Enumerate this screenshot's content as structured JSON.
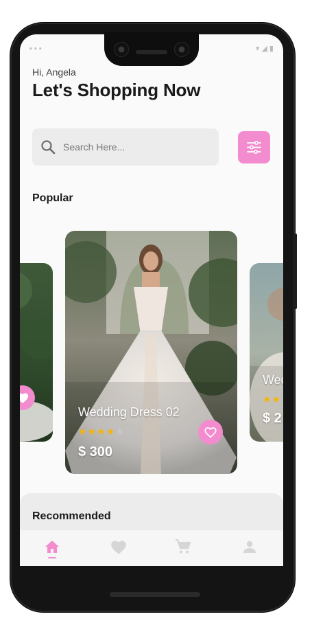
{
  "header": {
    "greeting": "Hi, Angela",
    "title": "Let's Shopping Now"
  },
  "search": {
    "placeholder": "Search Here...",
    "icon": "search-icon"
  },
  "filter": {
    "icon": "sliders-icon"
  },
  "sections": {
    "popular": "Popular",
    "recommended": "Recommended"
  },
  "popular_cards": {
    "left": {
      "icon": "heart-icon"
    },
    "main": {
      "title": "Wedding Dress 02",
      "rating": 4,
      "max_rating": 5,
      "price": "$ 300",
      "icon": "heart-outline-icon"
    },
    "right": {
      "title": "Wed",
      "rating": 2,
      "price": "$ 2"
    }
  },
  "bottom_nav": {
    "items": [
      {
        "icon": "home-icon",
        "active": true
      },
      {
        "icon": "heart-icon",
        "active": false
      },
      {
        "icon": "cart-icon",
        "active": false
      },
      {
        "icon": "person-icon",
        "active": false
      }
    ]
  },
  "colors": {
    "accent": "#f38ccf",
    "star": "#f7b500",
    "nav_inactive": "#d6d6d6"
  }
}
